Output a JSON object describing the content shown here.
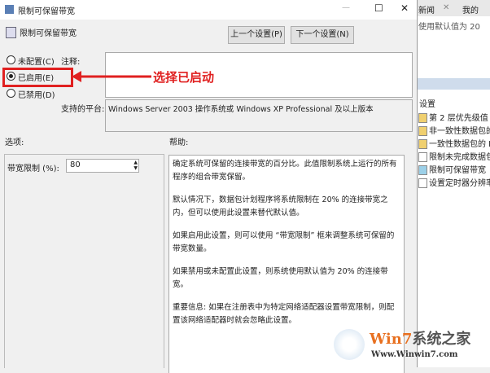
{
  "window": {
    "title": "限制可保留带宽",
    "minimize": "—",
    "maximize": "☐",
    "close": "✕"
  },
  "header": {
    "title": "限制可保留带宽",
    "prev_button": "上一个设置(P)",
    "next_button": "下一个设置(N)"
  },
  "radios": [
    {
      "label": "未配置(C)",
      "checked": false
    },
    {
      "label": "已启用(E)",
      "checked": true
    },
    {
      "label": "已禁用(D)",
      "checked": false
    }
  ],
  "comment": {
    "label": "注释:",
    "value": ""
  },
  "platform": {
    "label": "支持的平台:",
    "value": "Windows Server 2003 操作系统或 Windows XP Professional 及以上版本"
  },
  "options": {
    "label": "选项:",
    "field_label": "带宽限制 (%):",
    "field_value": "80"
  },
  "help": {
    "label": "帮助:",
    "paragraphs": [
      "确定系统可保留的连接带宽的百分比。此值限制系统上运行的所有程序的组合带宽保留。",
      "默认情况下，数据包计划程序将系统限制在 20% 的连接带宽之内，但可以使用此设置来替代默认值。",
      "如果启用此设置，则可以使用 “带宽限制” 框来调整系统可保留的带宽数量。",
      "如果禁用或未配置此设置，则系统使用默认值为 20% 的连接带宽。",
      "重要信息: 如果在注册表中为特定网络适配器设置带宽限制，则配置该网络适配器时就会忽略此设置。"
    ]
  },
  "annotation": {
    "text": "选择已启动",
    "color": "#e02020"
  },
  "background_window": {
    "tab1": "新闻",
    "tab1_close": "✕",
    "tab2": "我的",
    "line": "使用默认值为 20",
    "section": "设置",
    "items": [
      "第 2 层优先级值",
      "非一致性数据包的",
      "一致性数据包的 D",
      "限制未完成数据包",
      "限制可保留带宽",
      "设置定时器分辨率"
    ]
  },
  "watermark": {
    "brand": "Win7系统之家",
    "url": "Www.Winwin7.com"
  }
}
